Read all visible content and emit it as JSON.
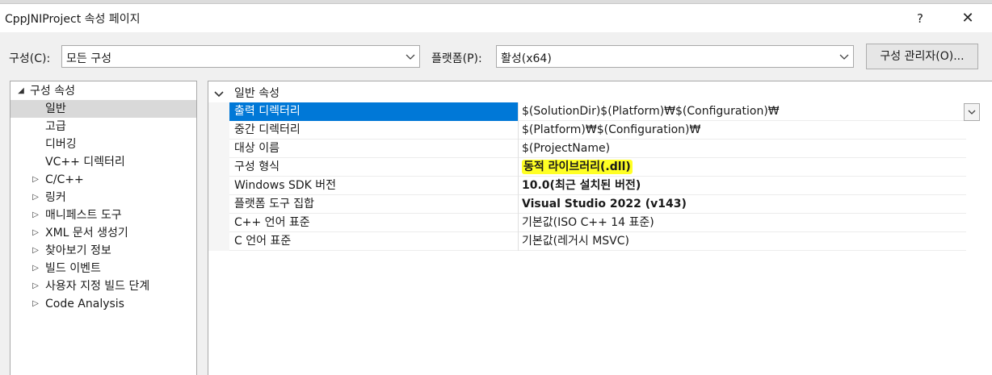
{
  "window": {
    "title": "CppJNIProject 속성 페이지",
    "help_glyph": "?",
    "close_glyph": "✕"
  },
  "toolbar": {
    "config_label": "구성(C):",
    "config_value": "모든 구성",
    "platform_label": "플랫폼(P):",
    "platform_value": "활성(x64)",
    "config_manager_button": "구성 관리자(O)..."
  },
  "tree": {
    "items": [
      {
        "label": "구성 속성",
        "expanded": true,
        "level": 0
      },
      {
        "label": "일반",
        "selected": true,
        "level": 1
      },
      {
        "label": "고급",
        "level": 1
      },
      {
        "label": "디버깅",
        "level": 1
      },
      {
        "label": "VC++ 디렉터리",
        "level": 1
      },
      {
        "label": "C/C++",
        "collapsed": true,
        "level": 1
      },
      {
        "label": "링커",
        "collapsed": true,
        "level": 1
      },
      {
        "label": "매니페스트 도구",
        "collapsed": true,
        "level": 1
      },
      {
        "label": "XML 문서 생성기",
        "collapsed": true,
        "level": 1
      },
      {
        "label": "찾아보기 정보",
        "collapsed": true,
        "level": 1
      },
      {
        "label": "빌드 이벤트",
        "collapsed": true,
        "level": 1
      },
      {
        "label": "사용자 지정 빌드 단계",
        "collapsed": true,
        "level": 1
      },
      {
        "label": "Code Analysis",
        "collapsed": true,
        "level": 1
      }
    ]
  },
  "grid": {
    "category": "일반 속성",
    "rows": [
      {
        "name": "출력 디렉터리",
        "value": "$(SolutionDir)$(Platform)₩$(Configuration)₩",
        "selected": true
      },
      {
        "name": "중간 디렉터리",
        "value": "$(Platform)₩$(Configuration)₩"
      },
      {
        "name": "대상 이름",
        "value": "$(ProjectName)"
      },
      {
        "name": "구성 형식",
        "value": "동적 라이브러리(.dll)",
        "bold": true,
        "highlighted": true
      },
      {
        "name": "Windows SDK 버전",
        "value": "10.0(최근 설치된 버전)",
        "bold": true
      },
      {
        "name": "플랫폼 도구 집합",
        "value": "Visual Studio 2022 (v143)",
        "bold": true
      },
      {
        "name": "C++ 언어 표준",
        "value": "기본값(ISO C++ 14 표준)"
      },
      {
        "name": "C 언어 표준",
        "value": "기본값(레거시 MSVC)"
      }
    ]
  },
  "colors": {
    "selection": "#0078d7",
    "highlight": "#ffff24"
  }
}
